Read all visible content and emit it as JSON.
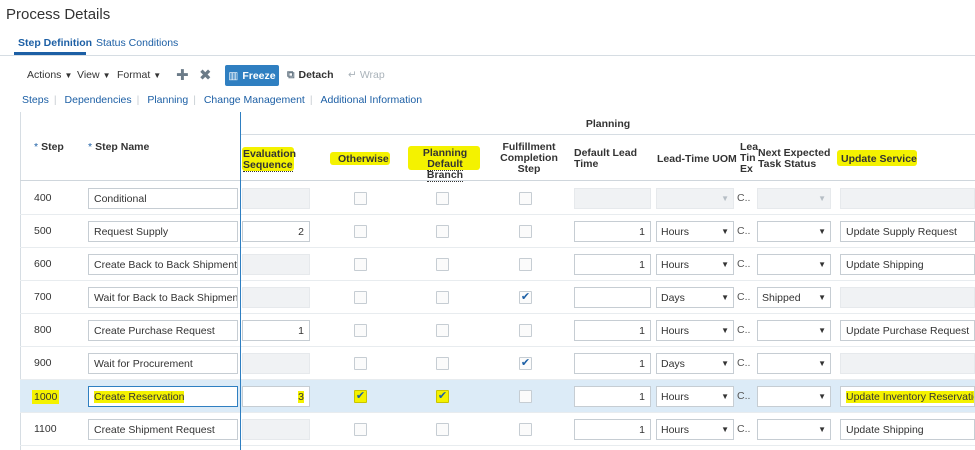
{
  "page": {
    "title": "Process Details"
  },
  "tabs": [
    {
      "label": "Step Definition",
      "active": true
    },
    {
      "label": "Status Conditions",
      "active": false
    }
  ],
  "toolbar": {
    "actions_label": "Actions",
    "view_label": "View",
    "format_label": "Format",
    "freeze_label": "Freeze",
    "detach_label": "Detach",
    "wrap_label": "Wrap"
  },
  "subtabs": [
    "Steps",
    "Dependencies",
    "Planning",
    "Change Management",
    "Additional Information"
  ],
  "grid": {
    "group_header": "Planning",
    "required_mark": "*",
    "columns": {
      "step": "Step",
      "step_name": "Step Name",
      "eval_seq_1": "Evaluation",
      "eval_seq_2": "Sequence",
      "otherwise": "Otherwise",
      "planning_default_1": "Planning",
      "planning_default_2": "Default Branch",
      "fulfillment_1": "Fulfillment",
      "fulfillment_2": "Completion",
      "fulfillment_3": "Step",
      "default_lead_1": "Default Lead",
      "default_lead_2": "Time",
      "lead_uom": "Lead-Time UOM",
      "lead_trunc_1": "Lea",
      "lead_trunc_2": "Tin",
      "lead_trunc_3": "Ex",
      "next_status_1": "Next Expected",
      "next_status_2": "Task Status",
      "update_service": "Update Service"
    },
    "rows": [
      {
        "step": "400",
        "name": "Conditional",
        "eval": "",
        "otherwise": false,
        "planning_default": false,
        "fulfillment": false,
        "lead_time": "",
        "uom": "",
        "trunc": "C..",
        "next_status": "",
        "update_service": ""
      },
      {
        "step": "500",
        "name": "Request Supply",
        "eval": "2",
        "otherwise": false,
        "planning_default": false,
        "fulfillment": false,
        "lead_time": "1",
        "uom": "Hours",
        "trunc": "C..",
        "next_status": "",
        "update_service": "Update Supply Request"
      },
      {
        "step": "600",
        "name": "Create Back to Back Shipment Req",
        "eval": "",
        "otherwise": false,
        "planning_default": false,
        "fulfillment": false,
        "lead_time": "1",
        "uom": "Hours",
        "trunc": "C..",
        "next_status": "",
        "update_service": "Update Shipping"
      },
      {
        "step": "700",
        "name": "Wait for Back to Back Shipment Ad",
        "eval": "",
        "otherwise": false,
        "planning_default": false,
        "fulfillment": true,
        "lead_time": "",
        "uom": "Days",
        "trunc": "C..",
        "next_status": "Shipped",
        "update_service": ""
      },
      {
        "step": "800",
        "name": "Create Purchase Request",
        "eval": "1",
        "otherwise": false,
        "planning_default": false,
        "fulfillment": false,
        "lead_time": "1",
        "uom": "Hours",
        "trunc": "C..",
        "next_status": "",
        "update_service": "Update Purchase Request"
      },
      {
        "step": "900",
        "name": "Wait for Procurement",
        "eval": "",
        "otherwise": false,
        "planning_default": false,
        "fulfillment": true,
        "lead_time": "1",
        "uom": "Days",
        "trunc": "C..",
        "next_status": "",
        "update_service": ""
      },
      {
        "step": "1000",
        "name": "Create Reservation",
        "eval": "3",
        "otherwise": true,
        "planning_default": true,
        "fulfillment": false,
        "lead_time": "1",
        "uom": "Hours",
        "trunc": "C..",
        "next_status": "",
        "update_service": "Update Inventory Reservation"
      },
      {
        "step": "1100",
        "name": "Create Shipment Request",
        "eval": "",
        "otherwise": false,
        "planning_default": false,
        "fulfillment": false,
        "lead_time": "1",
        "uom": "Hours",
        "trunc": "C..",
        "next_status": "",
        "update_service": "Update Shipping"
      }
    ]
  },
  "colors": {
    "accent": "#1c5fa5",
    "button": "#2f7fc1",
    "highlight": "#f4f200",
    "selected_row": "#dcebf7"
  }
}
